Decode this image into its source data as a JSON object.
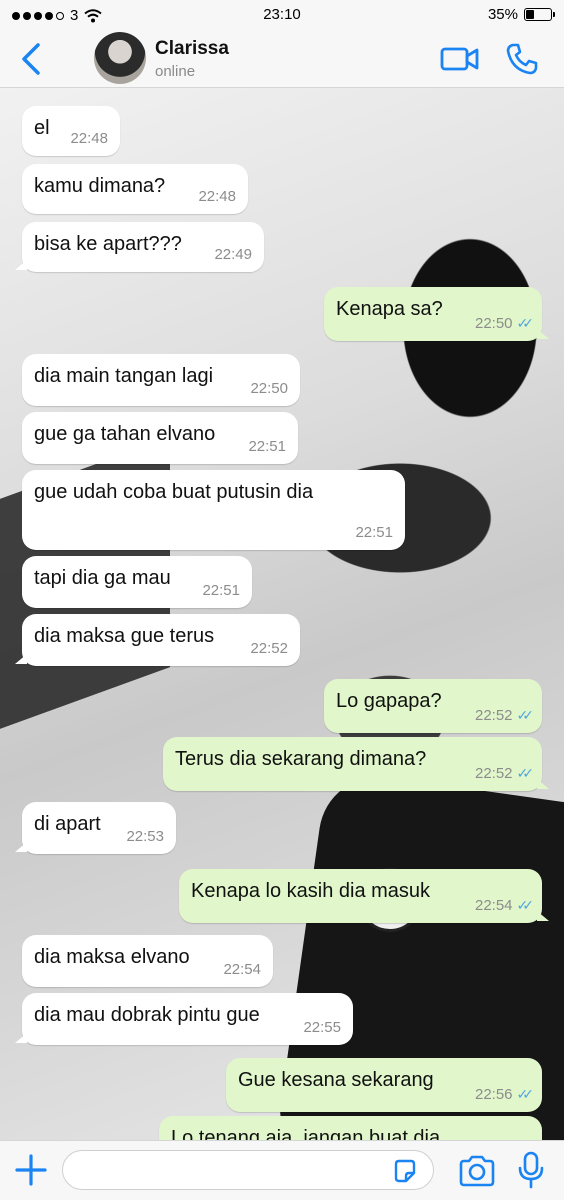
{
  "status_bar": {
    "carrier": "3",
    "time": "23:10",
    "battery_percent": "35%",
    "battery_level": 0.35
  },
  "header": {
    "contact_name": "Clarissa",
    "contact_status": "online"
  },
  "messages": [
    {
      "direction": "in",
      "text": "el",
      "time": "22:48"
    },
    {
      "direction": "in",
      "text": "kamu dimana?",
      "time": "22:48"
    },
    {
      "direction": "in",
      "text": "bisa ke apart???",
      "time": "22:49"
    },
    {
      "direction": "out",
      "text": "Kenapa sa?",
      "time": "22:50",
      "read": true
    },
    {
      "direction": "in",
      "text": "dia main tangan lagi",
      "time": "22:50"
    },
    {
      "direction": "in",
      "text": "gue ga tahan elvano",
      "time": "22:51"
    },
    {
      "direction": "in",
      "text": "gue udah coba buat putusin dia",
      "time": "22:51"
    },
    {
      "direction": "in",
      "text": "tapi dia ga mau",
      "time": "22:51"
    },
    {
      "direction": "in",
      "text": "dia maksa gue terus",
      "time": "22:52"
    },
    {
      "direction": "out",
      "text": "Lo gapapa?",
      "time": "22:52",
      "read": true
    },
    {
      "direction": "out",
      "text": "Terus dia sekarang dimana?",
      "time": "22:52",
      "read": true
    },
    {
      "direction": "in",
      "text": "di apart",
      "time": "22:53"
    },
    {
      "direction": "out",
      "text": "Kenapa lo kasih dia masuk",
      "time": "22:54",
      "read": true
    },
    {
      "direction": "in",
      "text": "dia maksa elvano",
      "time": "22:54"
    },
    {
      "direction": "in",
      "text": "dia mau dobrak pintu gue",
      "time": "22:55"
    },
    {
      "direction": "out",
      "text": "Gue kesana sekarang",
      "time": "22:56",
      "read": true
    },
    {
      "direction": "out",
      "text": "Lo tenang aja, jangan buat dia",
      "time": "",
      "read": false
    }
  ],
  "input": {
    "value": "",
    "placeholder": ""
  },
  "colors": {
    "accent": "#1a84f2",
    "outgoing_bubble": "#e1f7cb",
    "incoming_bubble": "#ffffff",
    "read_ticks": "#4fa4e6"
  },
  "icons": {
    "back": "chevron-left-icon",
    "video": "video-camera-icon",
    "call": "phone-icon",
    "plus": "plus-icon",
    "sticker": "sticker-icon",
    "camera": "camera-icon",
    "mic": "microphone-icon"
  }
}
